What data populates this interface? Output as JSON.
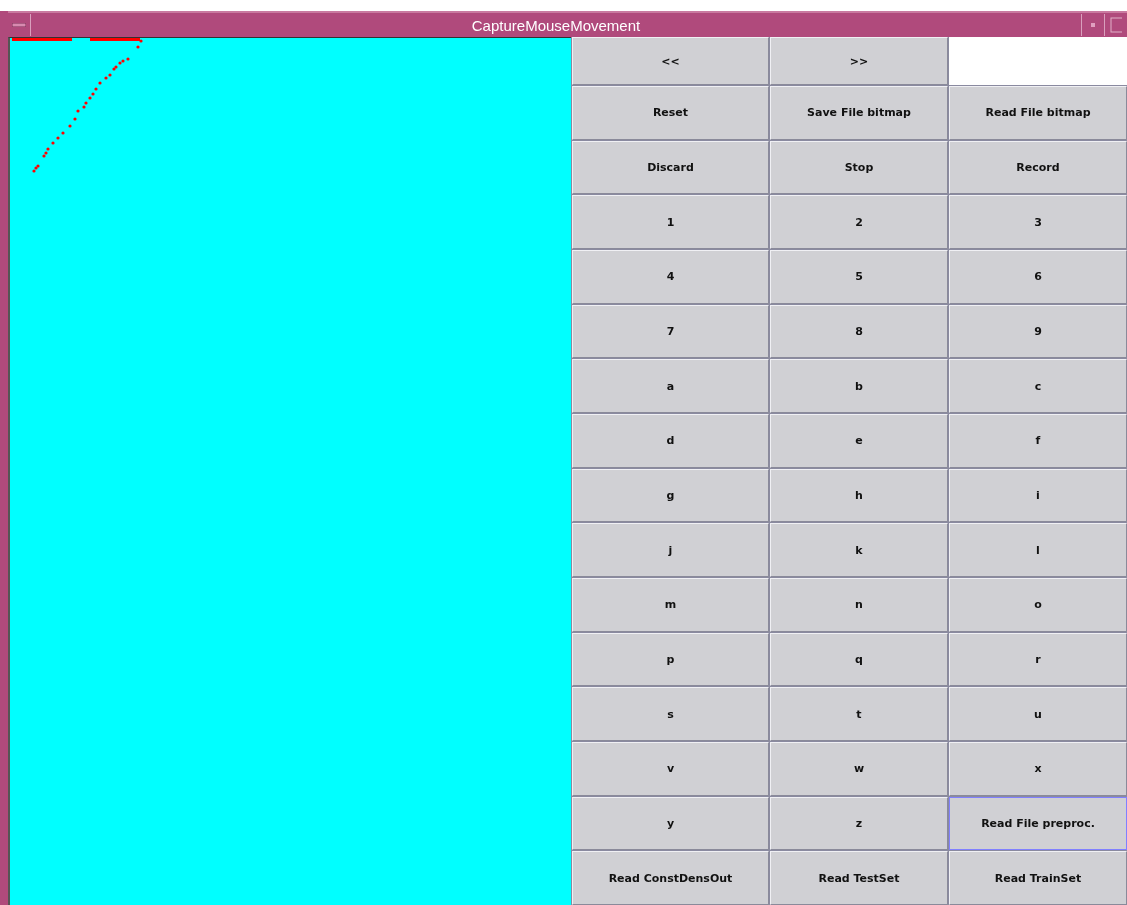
{
  "window": {
    "title": "CaptureMouseMovement"
  },
  "rows": [
    [
      {
        "kind": "button",
        "label": "<<",
        "focused": false
      },
      {
        "kind": "button",
        "label": ">>",
        "focused": false
      },
      {
        "kind": "field"
      }
    ],
    [
      {
        "kind": "button",
        "label": "Reset",
        "focused": false
      },
      {
        "kind": "button",
        "label": "Save File bitmap",
        "focused": false
      },
      {
        "kind": "button",
        "label": "Read File bitmap",
        "focused": false
      }
    ],
    [
      {
        "kind": "button",
        "label": "Discard",
        "focused": false
      },
      {
        "kind": "button",
        "label": "Stop",
        "focused": false
      },
      {
        "kind": "button",
        "label": "Record",
        "focused": false
      }
    ],
    [
      {
        "kind": "button",
        "label": "1",
        "focused": false
      },
      {
        "kind": "button",
        "label": "2",
        "focused": false
      },
      {
        "kind": "button",
        "label": "3",
        "focused": false
      }
    ],
    [
      {
        "kind": "button",
        "label": "4",
        "focused": false
      },
      {
        "kind": "button",
        "label": "5",
        "focused": false
      },
      {
        "kind": "button",
        "label": "6",
        "focused": false
      }
    ],
    [
      {
        "kind": "button",
        "label": "7",
        "focused": false
      },
      {
        "kind": "button",
        "label": "8",
        "focused": false
      },
      {
        "kind": "button",
        "label": "9",
        "focused": false
      }
    ],
    [
      {
        "kind": "button",
        "label": "a",
        "focused": false
      },
      {
        "kind": "button",
        "label": "b",
        "focused": false
      },
      {
        "kind": "button",
        "label": "c",
        "focused": false
      }
    ],
    [
      {
        "kind": "button",
        "label": "d",
        "focused": false
      },
      {
        "kind": "button",
        "label": "e",
        "focused": false
      },
      {
        "kind": "button",
        "label": "f",
        "focused": false
      }
    ],
    [
      {
        "kind": "button",
        "label": "g",
        "focused": false
      },
      {
        "kind": "button",
        "label": "h",
        "focused": false
      },
      {
        "kind": "button",
        "label": "i",
        "focused": false
      }
    ],
    [
      {
        "kind": "button",
        "label": "j",
        "focused": false
      },
      {
        "kind": "button",
        "label": "k",
        "focused": false
      },
      {
        "kind": "button",
        "label": "l",
        "focused": false
      }
    ],
    [
      {
        "kind": "button",
        "label": "m",
        "focused": false
      },
      {
        "kind": "button",
        "label": "n",
        "focused": false
      },
      {
        "kind": "button",
        "label": "o",
        "focused": false
      }
    ],
    [
      {
        "kind": "button",
        "label": "p",
        "focused": false
      },
      {
        "kind": "button",
        "label": "q",
        "focused": false
      },
      {
        "kind": "button",
        "label": "r",
        "focused": false
      }
    ],
    [
      {
        "kind": "button",
        "label": "s",
        "focused": false
      },
      {
        "kind": "button",
        "label": "t",
        "focused": false
      },
      {
        "kind": "button",
        "label": "u",
        "focused": false
      }
    ],
    [
      {
        "kind": "button",
        "label": "v",
        "focused": false
      },
      {
        "kind": "button",
        "label": "w",
        "focused": false
      },
      {
        "kind": "button",
        "label": "x",
        "focused": false
      }
    ],
    [
      {
        "kind": "button",
        "label": "y",
        "focused": false
      },
      {
        "kind": "button",
        "label": "z",
        "focused": false
      },
      {
        "kind": "button",
        "label": "Read File preproc.",
        "focused": true
      }
    ],
    [
      {
        "kind": "button",
        "label": "Read ConstDensOut",
        "focused": false
      },
      {
        "kind": "button",
        "label": "Read TestSet",
        "focused": false
      },
      {
        "kind": "button",
        "label": "Read TrainSet",
        "focused": false
      }
    ]
  ]
}
